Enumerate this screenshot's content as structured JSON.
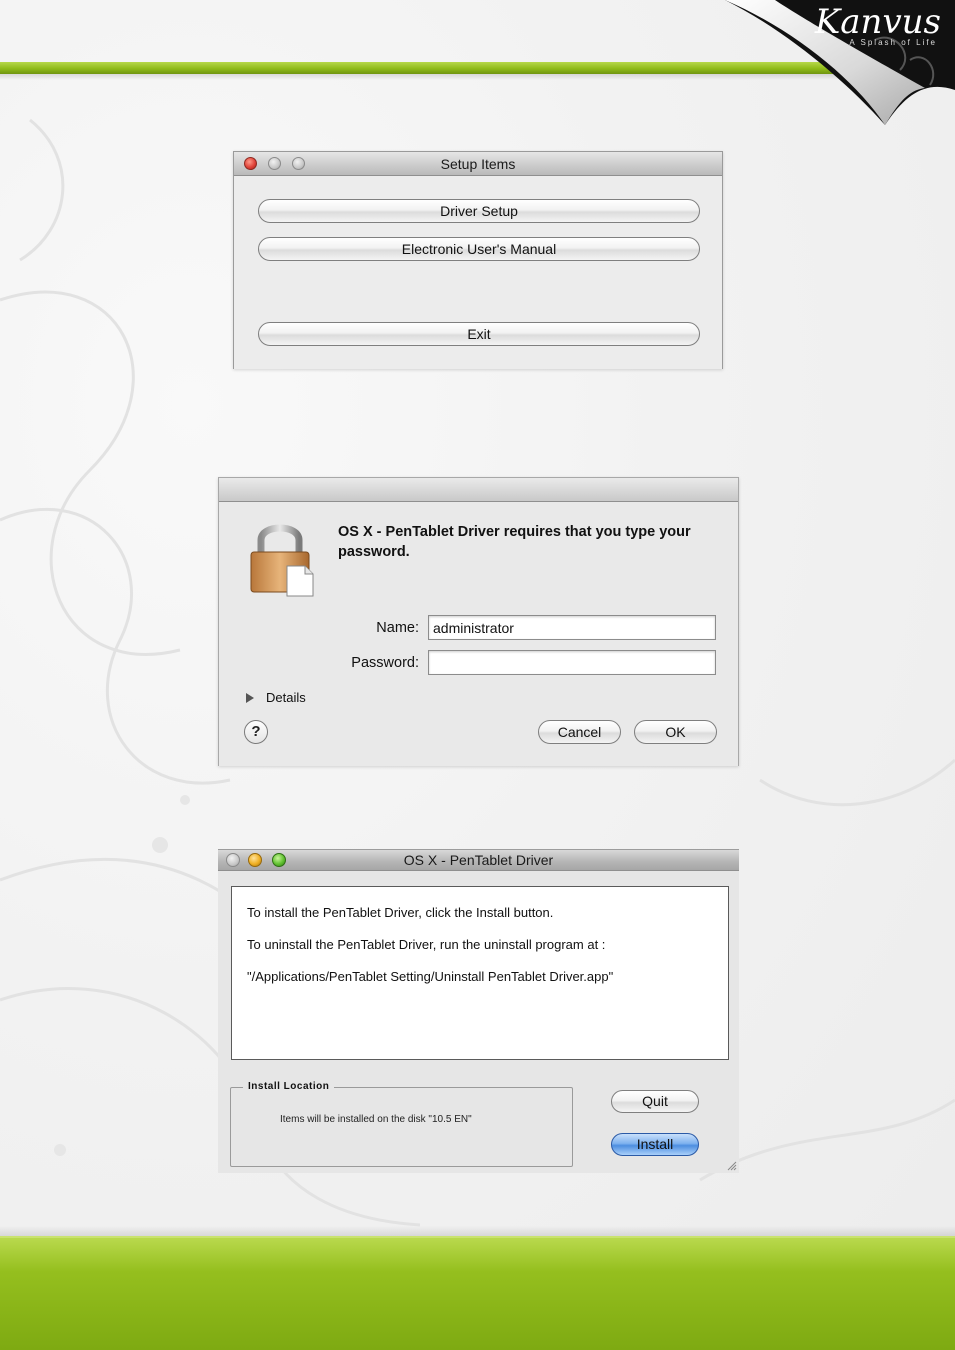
{
  "brand": {
    "name": "Kanvus",
    "tagline": "A Splash of Life"
  },
  "setup_window": {
    "title": "Setup Items",
    "buttons": [
      "Driver Setup",
      "Electronic User's Manual",
      "Exit"
    ]
  },
  "auth_window": {
    "message": "OS X - PenTablet Driver requires that you type your password.",
    "name_label": "Name:",
    "name_value": "administrator",
    "password_label": "Password:",
    "password_value": "",
    "details_label": "Details",
    "help_label": "?",
    "cancel_label": "Cancel",
    "ok_label": "OK"
  },
  "install_window": {
    "title": "OS X - PenTablet Driver",
    "info_lines": [
      "To install the PenTablet Driver, click the Install button.",
      "To uninstall the PenTablet Driver, run the uninstall program at :",
      "\"/Applications/PenTablet Setting/Uninstall PenTablet Driver.app\""
    ],
    "install_location": {
      "heading": "Install Location",
      "text": "Items will be installed on the disk \"10.5 EN\""
    },
    "quit_label": "Quit",
    "install_label": "Install"
  },
  "colors": {
    "accent_green": "#8fbb19",
    "default_button_blue": "#4d8ee0",
    "close_red": "#e0443a"
  }
}
